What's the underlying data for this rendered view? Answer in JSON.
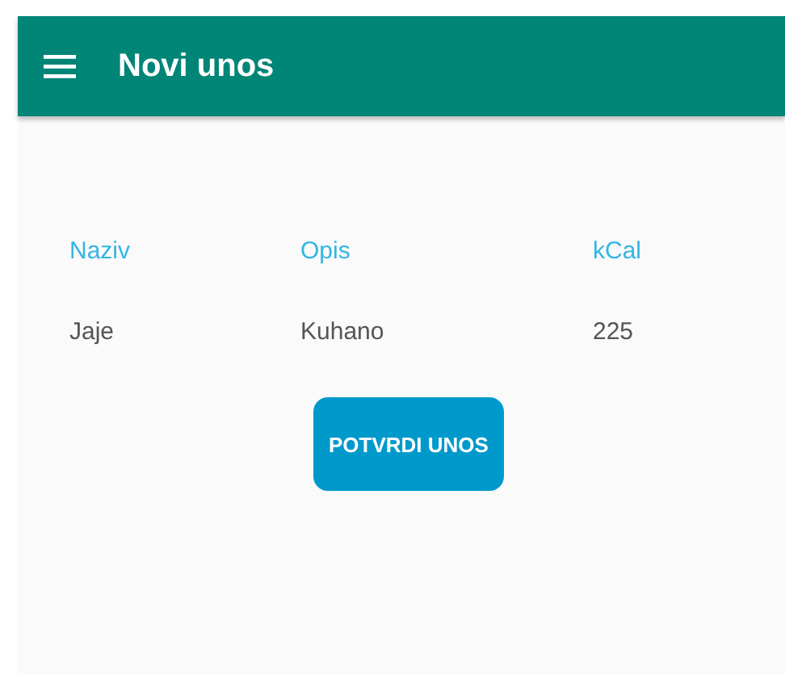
{
  "app_bar": {
    "title": "Novi unos"
  },
  "table": {
    "columns": [
      "Naziv",
      "Opis",
      "kCal"
    ],
    "rows": [
      [
        "Jaje",
        "Kuhano",
        "225"
      ]
    ]
  },
  "confirm_button": {
    "label": "POTVRDI UNOS"
  }
}
